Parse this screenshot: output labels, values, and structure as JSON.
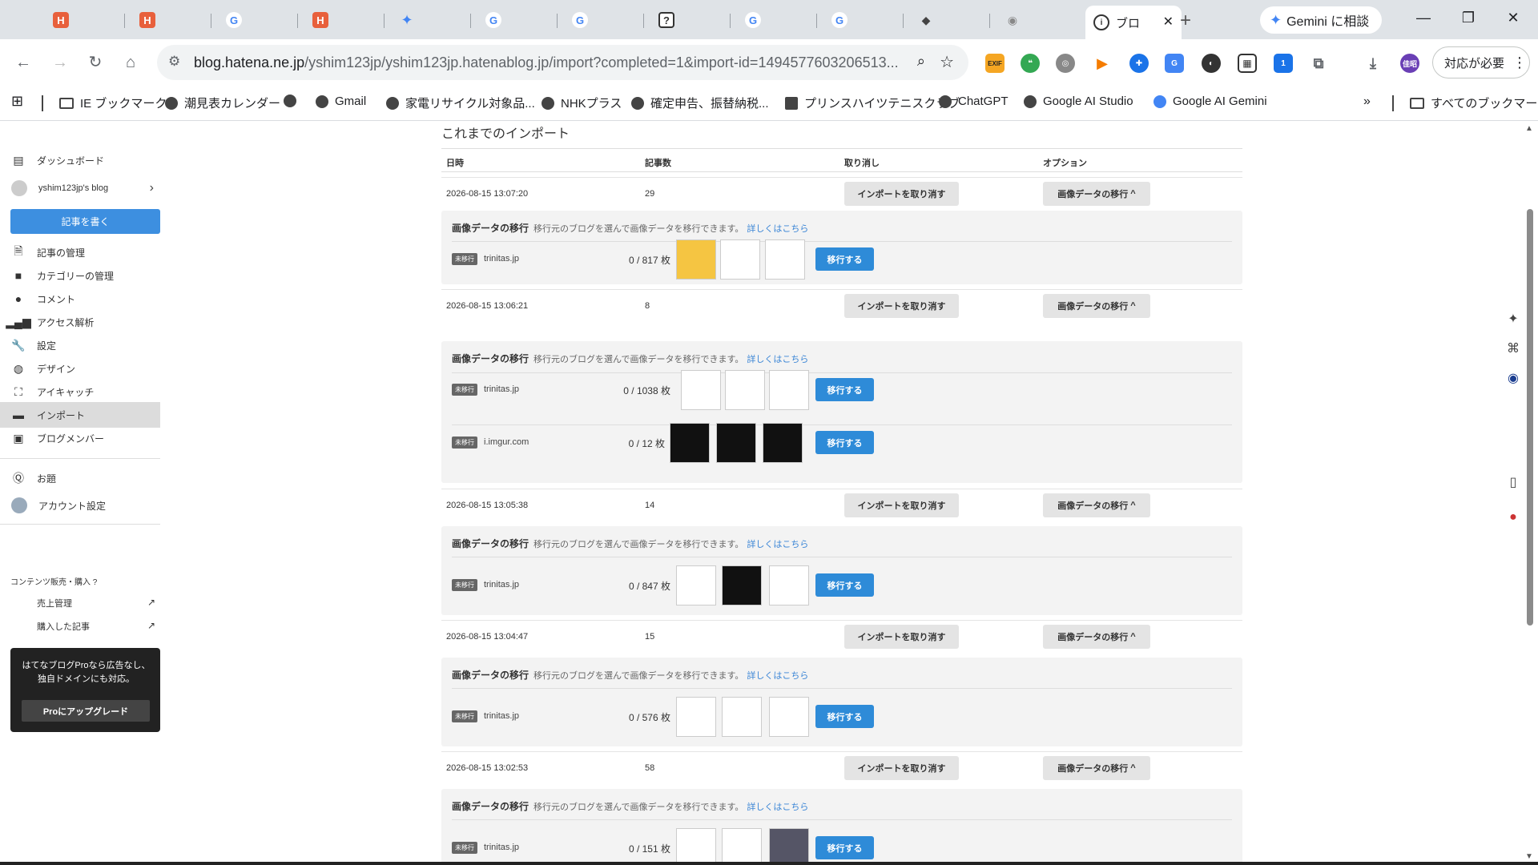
{
  "browser": {
    "active_tab_title": "ブロ",
    "gemini_button": "Gemini に相談",
    "url_host": "blog.hatena.ne.jp",
    "url_rest": "/yshim123jp/yshim123jp.hatenablog.jp/import?completed=1&import-id=1494577603206513...",
    "profile_button": "対応が必要",
    "ext_label": "EXIF",
    "avatar_label": "佳昭",
    "badge_count": "1"
  },
  "bookmarks": [
    "IE ブックマーク",
    "潮見表カレンダー",
    "",
    "Gmail",
    "家電リサイクル対象品...",
    "NHKプラス",
    "確定申告、振替納税...",
    "プリンスハイツテニスクラブ",
    "ChatGPT",
    "Google AI Studio",
    "Google AI Gemini"
  ],
  "bookmarks_all": "すべてのブックマーク",
  "sidebar": {
    "dashboard": "ダッシュボード",
    "blog_name": "yshim123jp's blog",
    "write": "記事を書く",
    "items": [
      {
        "label": "記事の管理",
        "icon": "article-icon"
      },
      {
        "label": "カテゴリーの管理",
        "icon": "folder-icon"
      },
      {
        "label": "コメント",
        "icon": "comment-icon"
      },
      {
        "label": "アクセス解析",
        "icon": "bar-chart-icon"
      },
      {
        "label": "設定",
        "icon": "wrench-icon"
      },
      {
        "label": "デザイン",
        "icon": "palette-icon"
      },
      {
        "label": "アイキャッチ",
        "icon": "eyecatch-icon"
      },
      {
        "label": "インポート",
        "icon": "import-icon"
      },
      {
        "label": "ブログメンバー",
        "icon": "member-icon"
      }
    ],
    "theme": "お題",
    "account": "アカウント設定",
    "content_sales": "コンテンツ販売・購入",
    "sales": "売上管理",
    "purchased": "購入した記事",
    "pro_text": "はてなブログProなら広告なし、独自ドメインにも対応。",
    "pro_button": "Proにアップグレード"
  },
  "main": {
    "section_title": "これまでのインポート",
    "headers": [
      "日時",
      "記事数",
      "取り消し",
      "オプション"
    ],
    "cancel_label": "インポートを取り消す",
    "option_label": "画像データの移行",
    "panel_title": "画像データの移行",
    "panel_desc": "移行元のブログを選んで画像データを移行できます。",
    "panel_link": "詳しくはこちら",
    "badge": "未移行",
    "migrate_label": "移行する",
    "imports": [
      {
        "date": "2026-08-15 13:07:20",
        "count": "29",
        "sources": [
          {
            "name": "trinitas.jp",
            "count": "0 / 817 枚"
          }
        ]
      },
      {
        "date": "2026-08-15 13:06:21",
        "count": "8",
        "sources": [
          {
            "name": "trinitas.jp",
            "count": "0 / 1038 枚"
          },
          {
            "name": "i.imgur.com",
            "count": "0 / 12 枚"
          }
        ]
      },
      {
        "date": "2026-08-15 13:05:38",
        "count": "14",
        "sources": [
          {
            "name": "trinitas.jp",
            "count": "0 / 847 枚"
          }
        ]
      },
      {
        "date": "2026-08-15 13:04:47",
        "count": "15",
        "sources": [
          {
            "name": "trinitas.jp",
            "count": "0 / 576 枚"
          }
        ]
      },
      {
        "date": "2026-08-15 13:02:53",
        "count": "58",
        "sources": [
          {
            "name": "trinitas.jp",
            "count": "0 / 151 枚"
          }
        ]
      }
    ]
  },
  "colors": {
    "accent": "#2e8bd8",
    "write_button": "#3d8fe0",
    "link": "#3a85d6"
  }
}
